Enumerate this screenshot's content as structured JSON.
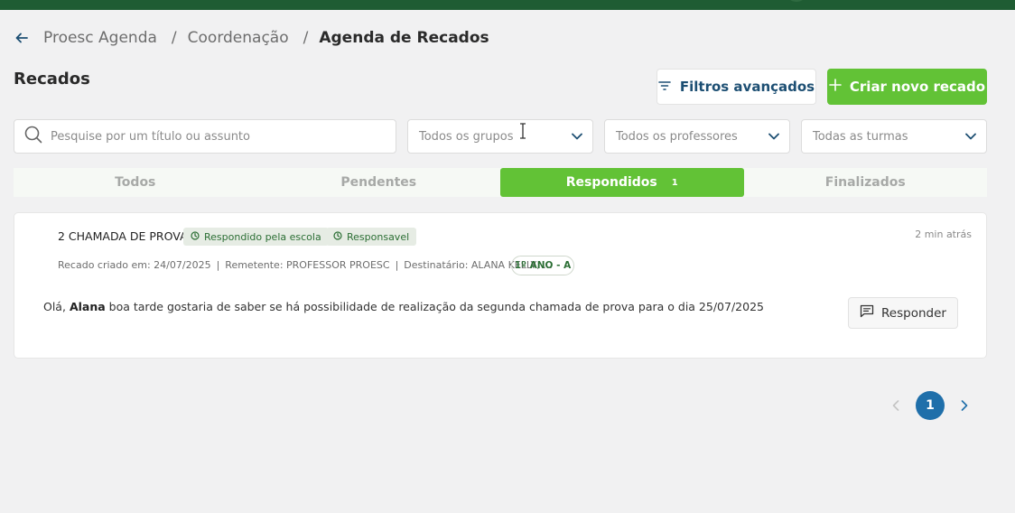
{
  "breadcrumb": {
    "items": [
      "Proesc Agenda",
      "Coordenação",
      "Agenda de Recados"
    ],
    "separator": "/"
  },
  "page": {
    "title": "Recados"
  },
  "actions": {
    "filters_label": "Filtros avançados",
    "create_label": "Criar novo recado"
  },
  "search": {
    "placeholder": "Pesquise por um título ou assunto",
    "value": ""
  },
  "filters": {
    "groups": "Todos os grupos",
    "teachers": "Todos os professores",
    "classes": "Todas as turmas"
  },
  "tabs": [
    {
      "label": "Todos"
    },
    {
      "label": "Pendentes"
    },
    {
      "label": "Respondidos",
      "count": "1",
      "active": true
    },
    {
      "label": "Finalizados"
    }
  ],
  "messages": [
    {
      "title": "2 CHAMADA DE PROVA",
      "badges": [
        "Respondido pela escola",
        "Responsavel"
      ],
      "time": "2 min atrás",
      "created": "Recado criado em: 24/07/2025",
      "sender": "Remetente: PROFESSOR PROESC",
      "recipient": "Destinatário: ALANA KELLY, ...",
      "class": "1º ANO - A",
      "greeting": "Olá,",
      "name": "Alana",
      "body": "boa tarde gostaria de saber se há possibilidade de realização da segunda chamada de prova para o dia 25/07/2025",
      "reply_label": "Responder"
    }
  ],
  "pagination": {
    "current": "1"
  },
  "colors": {
    "topbar": "#1f5c33",
    "accent_green": "#62c236",
    "link_blue": "#1d4f73",
    "pager_blue": "#1f6faa",
    "badge_text": "#2b6e34"
  },
  "icons": {
    "back": "arrow-left-icon",
    "filter": "filter-lines-icon",
    "create": "plus-icon",
    "search": "search-icon",
    "dropdown": "chevron-down-icon",
    "badge": "clock-icon",
    "reply": "message-icon",
    "prev": "chevron-left-icon",
    "next": "chevron-right-icon"
  }
}
